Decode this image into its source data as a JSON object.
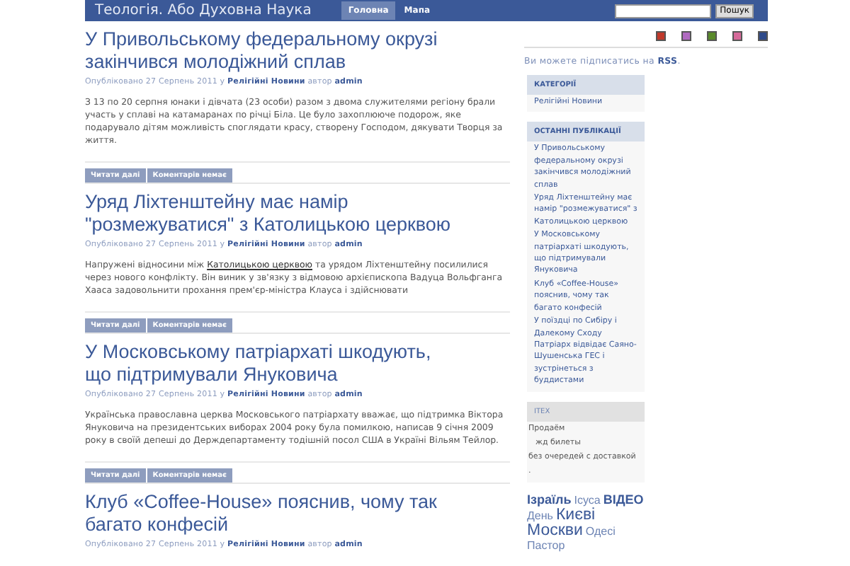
{
  "header": {
    "site_title": "Теологія. Або Духовна Наука",
    "nav": [
      {
        "label": "Головна",
        "selected": true
      },
      {
        "label": "Мапа",
        "selected": false
      }
    ],
    "search_button": "Пошук"
  },
  "color_swatches": [
    {
      "color": "#c0392b"
    },
    {
      "color": "#b06ac0"
    },
    {
      "color": "#5a8a2a"
    },
    {
      "color": "#d66a9a"
    },
    {
      "color": "#2e4a8a"
    }
  ],
  "posts": [
    {
      "title": "У Привольському федеральному окрузі закінчився молодіжний сплав",
      "meta": {
        "published": "Опубліковано 27 Серпень 2011 у",
        "category": "Релігійні Новини",
        "author_label": "автор",
        "author": "admin"
      },
      "excerpt": [
        {
          "kind": "text",
          "text": "З 13 по 20 серпня юнаки і дівчата (23 особи) разом з двома служителями регіону брали участь у сплаві на катамаранах по річці Біла. Це було захоплююче подорож, яке подарувало дітям можливість споглядати красу, створену Господом, дякувати Творця за життя."
        }
      ],
      "buttons": [
        "Читати далі",
        "Коментарів немає"
      ]
    },
    {
      "title": "Уряд Ліхтенштейну має намір \"розмежуватися\" з Католицькою церквою",
      "meta": {
        "published": "Опубліковано 27 Серпень 2011 у",
        "category": "Релігійні Новини",
        "author_label": "автор",
        "author": "admin"
      },
      "excerpt": [
        {
          "kind": "text",
          "text": "Напружені відносини між "
        },
        {
          "kind": "link",
          "text": "Католицькою церквою"
        },
        {
          "kind": "text",
          "text": " та урядом Ліхтенштейну посилилися через нового конфлікту. Він виник у зв'язку з відмовою архієпископа Вадуца Вольфганга Хааса задовольнити прохання прем'єр-міністра Клауса і здійснювати"
        }
      ],
      "buttons": [
        "Читати далі",
        "Коментарів немає"
      ]
    },
    {
      "title": "У Московському патріархаті шкодують, що підтримували Януковича",
      "meta": {
        "published": "Опубліковано 27 Серпень 2011 у",
        "category": "Релігійні Новини",
        "author_label": "автор",
        "author": "admin"
      },
      "excerpt": [
        {
          "kind": "text",
          "text": "Українська православна церква Московського патріархату вважає, що підтримка Віктора Януковича на президентських виборах 2004 року була помилкою, написав 9 січня 2009 року в своїй депеші до Держдепартаменту тодішній посол США в Україні Вільям Тейлор."
        }
      ],
      "buttons": [
        "Читати далі",
        "Коментарів немає"
      ]
    },
    {
      "title": "Клуб «Coffee-House» пояснив, чому так багато конфесій",
      "meta": {
        "published": "Опубліковано 27 Серпень 2011 у",
        "category": "Релігійні Новини",
        "author_label": "автор",
        "author": "admin"
      }
    }
  ],
  "sidebar": {
    "rss": {
      "text": "Ви можете підписатись на",
      "link": "RSS",
      "end": "."
    },
    "categories": {
      "heading": "КАТЕГОРІЇ",
      "items": [
        "Релігійні Новини"
      ]
    },
    "recent": {
      "heading": "ОСТАННІ ПУБЛІКАЦІЇ",
      "items": [
        "У Привольському федеральному окрузі закінчився молодіжний сплав",
        "Уряд Ліхтенштейну має намір \"розмежуватися\" з Католицькою церквою",
        "У Московському патріархаті шкодують, що підтримували Януковича",
        "Клуб «Coffee-House» пояснив, чому так багато конфесій",
        "У поїздці по Сибіру і Далекому Сходу Патріарх відвідає Саяно-Шушенська ГЕС і зустрінеться з буддистами"
      ]
    },
    "itex": {
      "heading": "ITEX",
      "lines": [
        "Продаём",
        "жд билеты",
        "без очередей с доставкой",
        "."
      ]
    },
    "tags": [
      {
        "text": "Ізраїль",
        "kind": "medium"
      },
      {
        "text": "Ісуса",
        "kind": "small"
      },
      {
        "text": "ВІДЕО",
        "kind": "medium"
      },
      {
        "text": "День",
        "kind": "small"
      },
      {
        "text": "Києві",
        "kind": "large"
      },
      {
        "text": "Москви",
        "kind": "large"
      },
      {
        "text": "Одесі",
        "kind": "small"
      },
      {
        "text": "Пастор",
        "kind": "small"
      }
    ]
  }
}
